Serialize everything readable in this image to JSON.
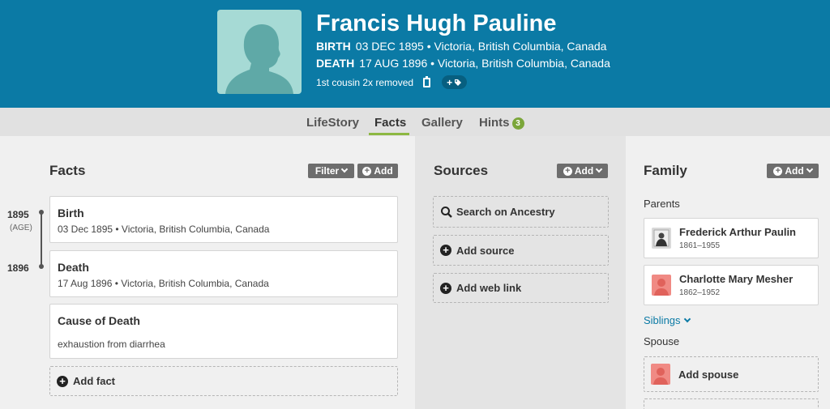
{
  "person": {
    "name": "Francis Hugh Pauline",
    "birth_label": "BIRTH",
    "birth_text": "03 DEC 1895 • Victoria, British Columbia, Canada",
    "death_label": "DEATH",
    "death_text": "17 AUG 1896 • Victoria, British Columbia, Canada",
    "relationship": "1st cousin 2x removed",
    "tag_button": "+"
  },
  "tabs": [
    {
      "label": "LifeStory",
      "active": false
    },
    {
      "label": "Facts",
      "active": true
    },
    {
      "label": "Gallery",
      "active": false
    },
    {
      "label": "Hints",
      "badge": "3",
      "active": false
    }
  ],
  "facts": {
    "title": "Facts",
    "filter_label": "Filter",
    "add_label": "Add",
    "timeline": {
      "year1": "1895",
      "age_label": "(AGE)",
      "year2": "1896"
    },
    "items": [
      {
        "title": "Birth",
        "detail": "03 Dec 1895 • Victoria, British Columbia, Canada"
      },
      {
        "title": "Death",
        "detail": "17 Aug 1896 • Victoria, British Columbia, Canada"
      },
      {
        "title": "Cause of Death",
        "detail": "exhaustion from diarrhea"
      }
    ],
    "add_fact_label": "Add fact"
  },
  "sources": {
    "title": "Sources",
    "add_label": "Add",
    "search_label": "Search on Ancestry",
    "add_source_label": "Add source",
    "add_weblink_label": "Add web link"
  },
  "family": {
    "title": "Family",
    "add_label": "Add",
    "parents_label": "Parents",
    "parents": [
      {
        "name": "Frederick Arthur Paulin",
        "dates": "1861–1955"
      },
      {
        "name": "Charlotte Mary Mesher",
        "dates": "1862–1952"
      }
    ],
    "siblings_label": "Siblings",
    "spouse_label": "Spouse",
    "add_spouse_label": "Add spouse"
  },
  "colors": {
    "header_bg": "#0b7aa5",
    "accent_green": "#8db842",
    "badge_green": "#7ba63a",
    "female_icon": "#f08a84"
  }
}
